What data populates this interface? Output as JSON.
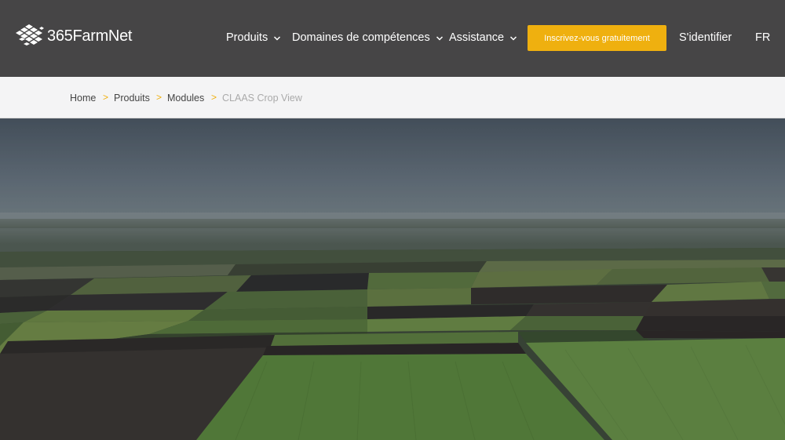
{
  "header": {
    "logo_text": "365FarmNet",
    "nav": [
      {
        "label": "Produits"
      },
      {
        "label": "Domaines de compétences"
      },
      {
        "label": "Assistance"
      }
    ],
    "cta_label": "Inscrivez-vous gratuitement",
    "login_label": "S'identifier",
    "language": "FR"
  },
  "breadcrumb": {
    "items": [
      "Home",
      "Produits",
      "Modules"
    ],
    "current": "CLAAS Crop View",
    "separator": ">"
  },
  "colors": {
    "header_bg": "#464546",
    "accent": "#efb00f",
    "breadcrumb_bg": "#f4f4f5"
  },
  "hero": {
    "image": "aerial-view-of-agricultural-fields"
  }
}
